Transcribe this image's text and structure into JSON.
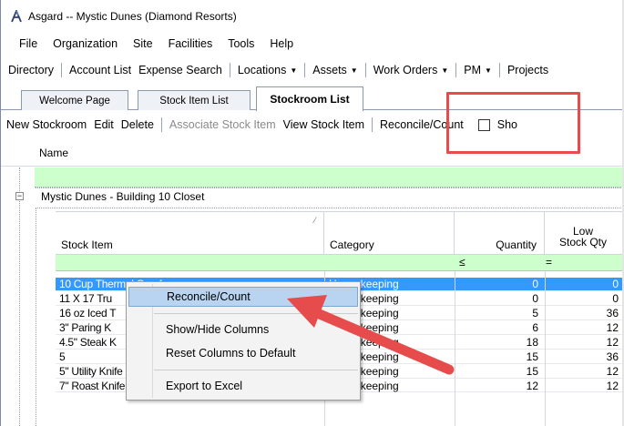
{
  "window": {
    "title": "Asgard -- Mystic Dunes (Diamond Resorts)"
  },
  "menu": [
    "File",
    "Organization",
    "Site",
    "Facilities",
    "Tools",
    "Help"
  ],
  "toolbar": {
    "items": [
      {
        "label": "Directory",
        "dropdown": false
      },
      {
        "label": "Account List",
        "dropdown": false
      },
      {
        "label": "Expense Search",
        "dropdown": false
      },
      {
        "label": "Locations",
        "dropdown": true
      },
      {
        "label": "Assets",
        "dropdown": true
      },
      {
        "label": "Work Orders",
        "dropdown": true
      },
      {
        "label": "PM",
        "dropdown": true
      },
      {
        "label": "Projects",
        "dropdown": false
      }
    ]
  },
  "tabs": [
    {
      "label": "Welcome Page",
      "active": false
    },
    {
      "label": "Stock Item List",
      "active": false
    },
    {
      "label": "Stockroom List",
      "active": true
    }
  ],
  "toolbar2": {
    "new_stockroom": "New Stockroom",
    "edit": "Edit",
    "delete": "Delete",
    "associate": "Associate Stock Item",
    "view": "View Stock Item",
    "reconcile": "Reconcile/Count",
    "show": "Sho"
  },
  "grid": {
    "name_header": "Name",
    "group": "Mystic Dunes - Building 10 Closet",
    "columns": {
      "stock_item": "Stock Item",
      "category": "Category",
      "quantity": "Quantity",
      "low_stock_line1": "Low",
      "low_stock_line2": "Stock Qty"
    },
    "filter_ops": {
      "quantity": "≤",
      "low": "="
    },
    "rows": [
      {
        "item": "10 Cup Thermal Carafe",
        "category": "Housekeeping",
        "qty": "0",
        "low": "0",
        "selected": true
      },
      {
        "item": "11 X 17 Tru",
        "category": "Housekeeping",
        "qty": "0",
        "low": "0",
        "selected": false
      },
      {
        "item": "16 oz Iced T",
        "category": "Housekeeping",
        "qty": "5",
        "low": "36",
        "selected": false
      },
      {
        "item": "3\" Paring K",
        "category": "Housekeeping",
        "qty": "6",
        "low": "12",
        "selected": false
      },
      {
        "item": "4.5\" Steak K",
        "category": "Housekeeping",
        "qty": "18",
        "low": "12",
        "selected": false
      },
      {
        "item": "5",
        "category": "Housekeeping",
        "qty": "15",
        "low": "36",
        "selected": false
      },
      {
        "item": "5\" Utility Knife",
        "category": "Housekeeping",
        "qty": "15",
        "low": "12",
        "selected": false
      },
      {
        "item": "7\" Roast Knife",
        "category": "Housekeeping",
        "qty": "12",
        "low": "12",
        "selected": false
      }
    ]
  },
  "context_menu": {
    "reconcile": "Reconcile/Count",
    "show_hide": "Show/Hide Columns",
    "reset": "Reset Columns to Default",
    "export": "Export to Excel"
  },
  "colors": {
    "highlight": "#e64c4c",
    "selection": "#3399ff",
    "filter_row": "#ccffcc",
    "menu_hover": "#b8d4f1"
  }
}
